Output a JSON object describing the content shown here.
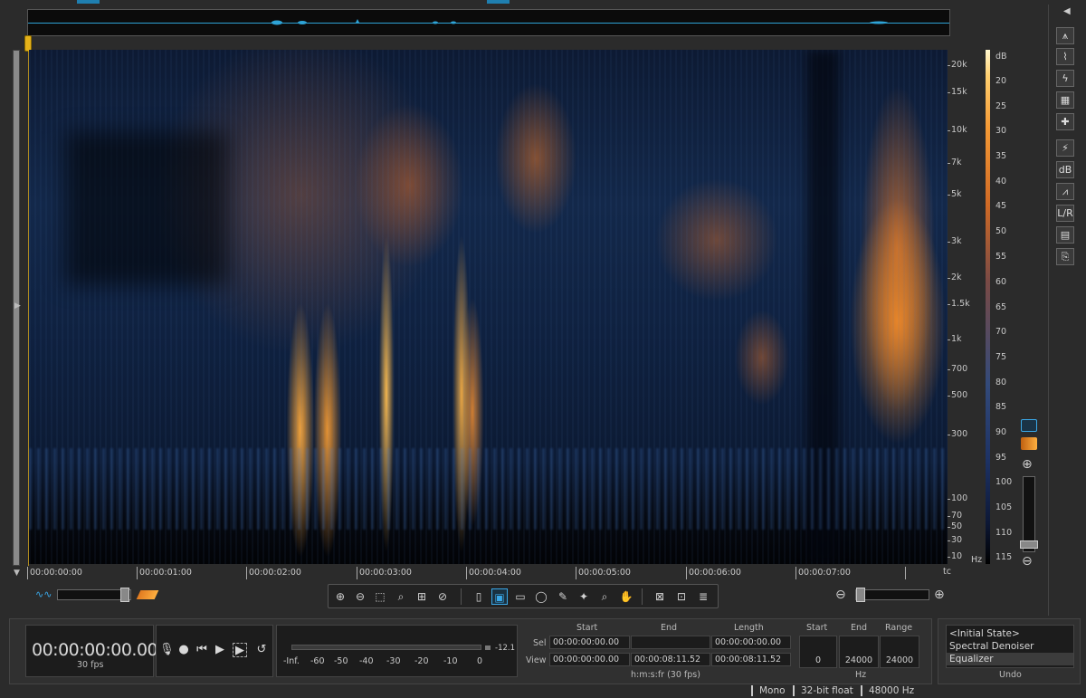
{
  "frequency_axis": {
    "unit": "Hz",
    "ticks": [
      {
        "label": "20k"
      },
      {
        "label": "15k"
      },
      {
        "label": "10k"
      },
      {
        "label": "7k"
      },
      {
        "label": "5k"
      },
      {
        "label": "3k"
      },
      {
        "label": "2k"
      },
      {
        "label": "1.5k"
      },
      {
        "label": "1k"
      },
      {
        "label": "700"
      },
      {
        "label": "500"
      },
      {
        "label": "300"
      },
      {
        "label": "100"
      },
      {
        "label": "70"
      },
      {
        "label": "50"
      },
      {
        "label": "30"
      },
      {
        "label": "10"
      }
    ]
  },
  "db_axis": {
    "unit": "dB",
    "ticks": [
      "20",
      "25",
      "30",
      "35",
      "40",
      "45",
      "50",
      "55",
      "60",
      "65",
      "70",
      "75",
      "80",
      "85",
      "90",
      "95",
      "100",
      "105",
      "110",
      "115"
    ]
  },
  "time_ruler": {
    "ticks": [
      "00:00:00:00",
      "00:00:01:00",
      "00:00:02:00",
      "00:00:03:00",
      "00:00:04:00",
      "00:00:05:00",
      "00:00:06:00",
      "00:00:07:00"
    ],
    "format_label": "tc"
  },
  "transport": {
    "time": "00:00:00:00.00",
    "fps": "30 fps"
  },
  "meter": {
    "peak": "-12.1",
    "labels": [
      "-Inf.",
      "-60",
      "-50",
      "-40",
      "-30",
      "-20",
      "-10",
      "0"
    ]
  },
  "selection": {
    "headers": {
      "start": "Start",
      "end": "End",
      "length": "Length"
    },
    "rows": {
      "sel": {
        "label": "Sel",
        "start": "00:00:00:00.00",
        "end": "",
        "length": "00:00:00:00.00"
      },
      "view": {
        "label": "View",
        "start": "00:00:00:00.00",
        "end": "00:00:08:11.52",
        "length": "00:00:08:11.52"
      }
    },
    "format": "h:m:s:fr (30 fps)"
  },
  "frequency_range": {
    "headers": {
      "start": "Start",
      "end": "End",
      "range": "Range"
    },
    "values": {
      "start": "0",
      "end": "24000",
      "range": "24000"
    },
    "unit": "Hz"
  },
  "undo": {
    "title": "Undo",
    "items": [
      "<Initial State>",
      "Spectral Denoiser",
      "Equalizer"
    ],
    "selected": "Equalizer"
  },
  "status": {
    "channels": "Mono",
    "bit_depth": "32-bit float",
    "sample_rate": "48000 Hz"
  },
  "colors": {
    "accent": "#3aa8e8",
    "playhead": "#e5b21a",
    "spectro_hot": "#f59a35"
  }
}
